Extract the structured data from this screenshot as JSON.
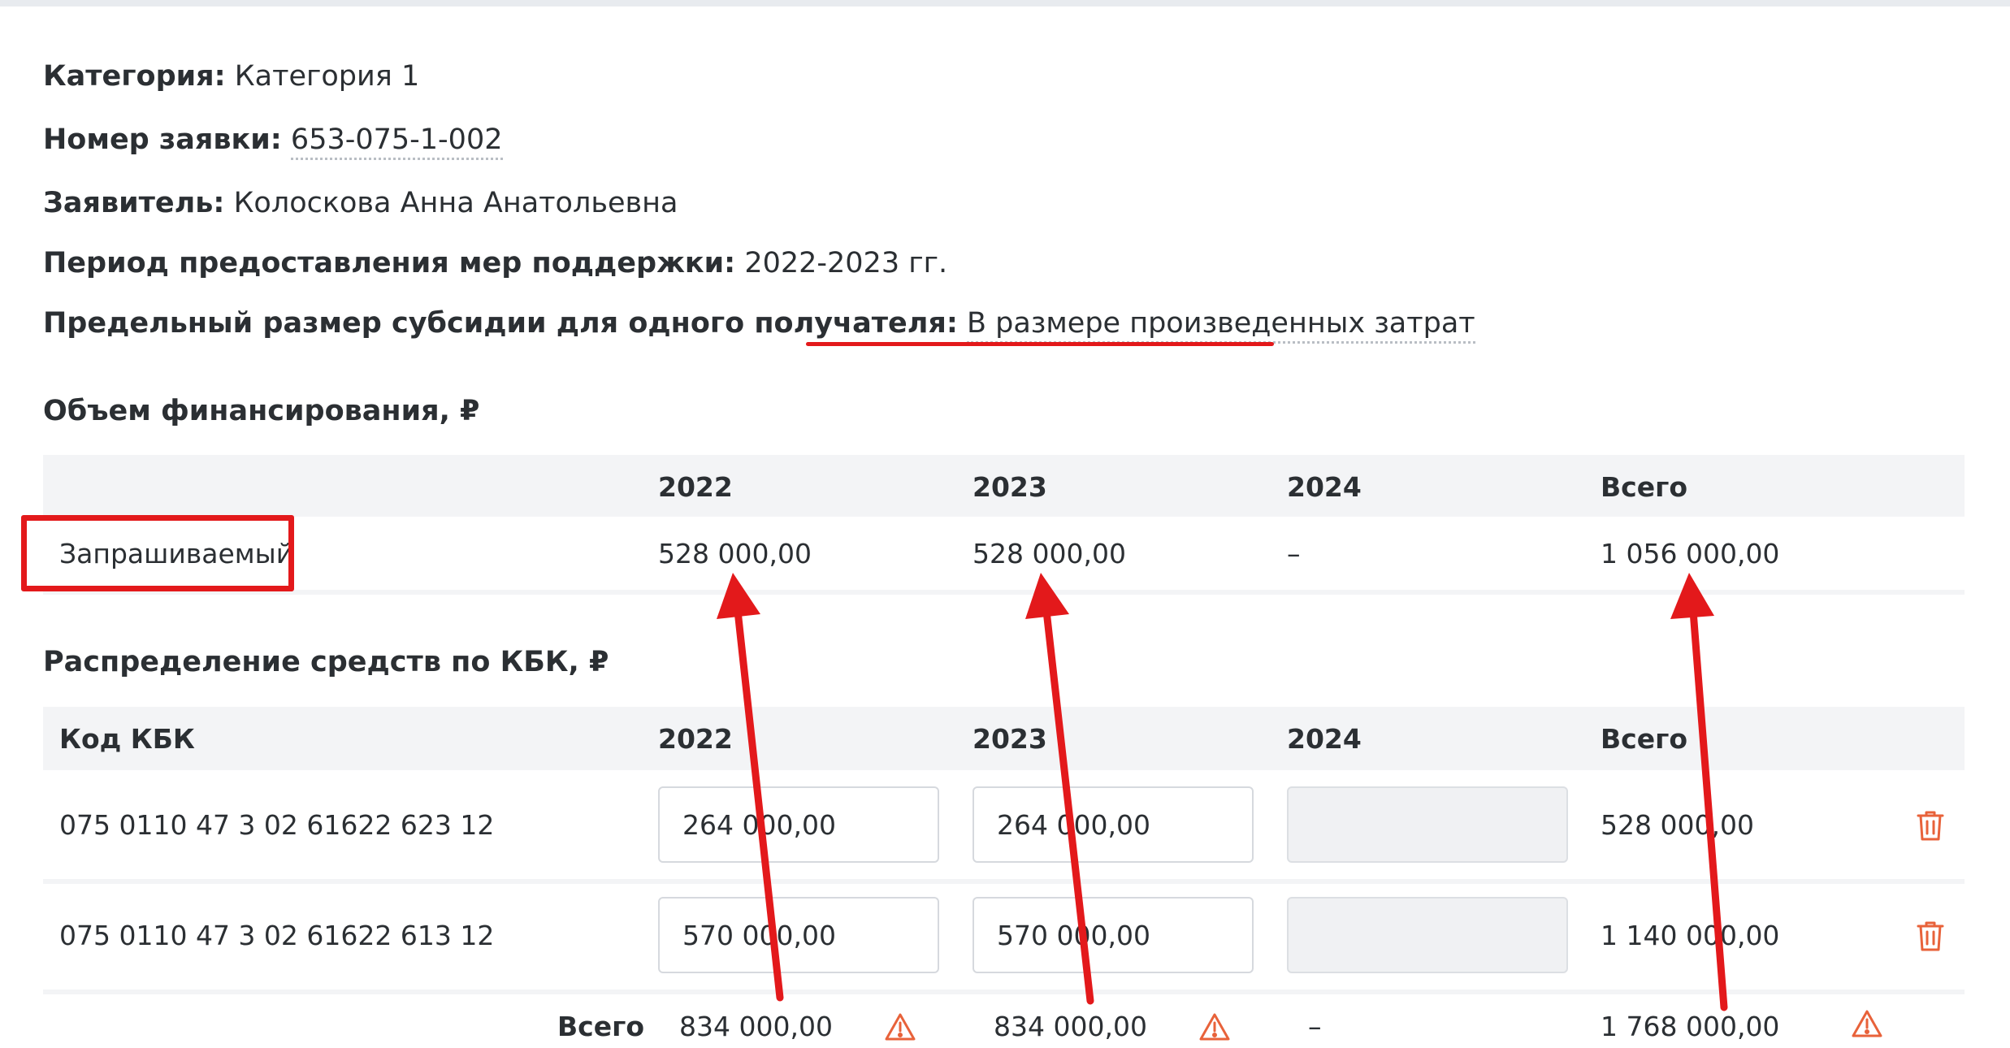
{
  "info": {
    "category_label": "Категория:",
    "category_value": "Категория 1",
    "number_label": "Номер заявки:",
    "number_value": "653-075-1-002",
    "applicant_label": "Заявитель:",
    "applicant_value": "Колоскова Анна Анатольевна",
    "period_label": "Период предоставления мер поддержки:",
    "period_value": "2022-2023 гг.",
    "limit_label": "Предельный размер субсидии для одного получателя:",
    "limit_value": "В размере произведенных затрат"
  },
  "funding": {
    "title": "Объем финансирования, ₽",
    "headers": [
      "2022",
      "2023",
      "2024",
      "Всего"
    ],
    "row": {
      "label": "Запрашиваемый",
      "values": [
        "528 000,00",
        "528 000,00",
        "–",
        "1 056 000,00"
      ]
    }
  },
  "kbk": {
    "title": "Распределение средств по КБК, ₽",
    "headers": [
      "Код КБК",
      "2022",
      "2023",
      "2024",
      "Всего"
    ],
    "rows": [
      {
        "code": "075 0110 47 3 02 61622 623 12",
        "v2022": "264 000,00",
        "v2023": "264 000,00",
        "v2024": "",
        "total": "528 000,00"
      },
      {
        "code": "075 0110 47 3 02 61622 613 12",
        "v2022": "570 000,00",
        "v2023": "570 000,00",
        "v2024": "",
        "total": "1 140 000,00"
      }
    ],
    "totals": {
      "label": "Всего",
      "v2022": "834 000,00",
      "v2023": "834 000,00",
      "v2024": "–",
      "total": "1 768 000,00"
    }
  },
  "colors": {
    "annotation_red": "#e3191b",
    "danger_icon": "#e8623a",
    "header_band": "#f3f4f6"
  },
  "icons": {
    "delete": "trash-icon",
    "warning": "warning-triangle-icon"
  }
}
